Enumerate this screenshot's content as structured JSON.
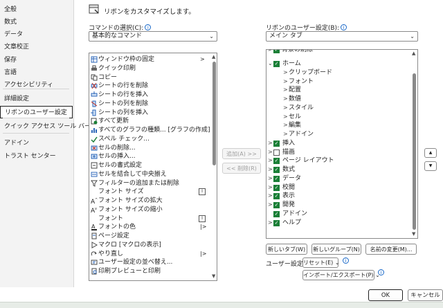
{
  "nav": {
    "items": [
      "全般",
      "数式",
      "データ",
      "文章校正",
      "保存",
      "言語",
      "アクセシビリティ",
      "詳細設定",
      "リボンのユーザー設定",
      "クイック アクセス ツール バー",
      "アドイン",
      "トラスト センター"
    ]
  },
  "header": {
    "title": "リボンをカスタマイズします。"
  },
  "commands": {
    "label": "コマンドの選択(C):",
    "selected": "基本的なコマンド",
    "items": [
      {
        "icon": "window-freeze-icon",
        "text": "ウィンドウ枠の固定",
        "arrow": ">"
      },
      {
        "icon": "quick-print-icon",
        "text": "クイック印刷",
        "arrow": ""
      },
      {
        "icon": "copy-icon",
        "text": "コピー",
        "arrow": ""
      },
      {
        "icon": "delete-row-icon",
        "text": "シートの行を削除",
        "arrow": ""
      },
      {
        "icon": "insert-row-icon",
        "text": "シートの行を挿入",
        "arrow": ""
      },
      {
        "icon": "delete-column-icon",
        "text": "シートの列を削除",
        "arrow": ""
      },
      {
        "icon": "insert-column-icon",
        "text": "シートの列を挿入",
        "arrow": ""
      },
      {
        "icon": "refresh-all-icon",
        "text": "すべて更新",
        "arrow": ""
      },
      {
        "icon": "chart-types-icon",
        "text": "すべてのグラフの種類... [グラフの作成]",
        "arrow": ""
      },
      {
        "icon": "spell-check-icon",
        "text": "スペル チェック...",
        "arrow": ""
      },
      {
        "icon": "delete-cells-icon",
        "text": "セルの削除...",
        "arrow": ""
      },
      {
        "icon": "insert-cells-icon",
        "text": "セルの挿入...",
        "arrow": ""
      },
      {
        "icon": "format-cells-icon",
        "text": "セルの書式設定",
        "arrow": ""
      },
      {
        "icon": "merge-center-icon",
        "text": "セルを結合して中央揃え",
        "arrow": ""
      },
      {
        "icon": "filter-icon",
        "text": "フィルターの追加または削除",
        "arrow": ""
      },
      {
        "icon": "",
        "text": "フォント サイズ",
        "arrow": "combo"
      },
      {
        "icon": "font-size-increase-icon",
        "text": "フォント サイズの拡大",
        "arrow": ""
      },
      {
        "icon": "font-size-decrease-icon",
        "text": "フォント サイズの縮小",
        "arrow": ""
      },
      {
        "icon": "",
        "text": "フォント",
        "arrow": "combo"
      },
      {
        "icon": "font-color-icon",
        "text": "フォントの色",
        "arrow": "|>"
      },
      {
        "icon": "page-setup-icon",
        "text": "ページ設定",
        "arrow": ""
      },
      {
        "icon": "macro-icon",
        "text": "マクロ [マクロの表示]",
        "arrow": ""
      },
      {
        "icon": "redo-icon",
        "text": "やり直し",
        "arrow": "|>"
      },
      {
        "icon": "custom-sort-icon",
        "text": "ユーザー設定の並べ替え...",
        "arrow": ""
      },
      {
        "icon": "print-preview-icon",
        "text": "印刷プレビューと印刷",
        "arrow": ""
      }
    ]
  },
  "ribbon": {
    "label": "リボンのユーザー設定(B):",
    "selected": "メイン タブ",
    "tree": [
      {
        "level": 0,
        "expander": "v",
        "check": "on",
        "text": "ホーム"
      },
      {
        "level": 1,
        "expander": ">",
        "check": "none",
        "text": "クリップボード"
      },
      {
        "level": 1,
        "expander": ">",
        "check": "none",
        "text": "フォント"
      },
      {
        "level": 1,
        "expander": ">",
        "check": "none",
        "text": "配置"
      },
      {
        "level": 1,
        "expander": ">",
        "check": "none",
        "text": "数値"
      },
      {
        "level": 1,
        "expander": ">",
        "check": "none",
        "text": "スタイル"
      },
      {
        "level": 1,
        "expander": ">",
        "check": "none",
        "text": "セル"
      },
      {
        "level": 1,
        "expander": ">",
        "check": "none",
        "text": "編集"
      },
      {
        "level": 1,
        "expander": ">",
        "check": "none",
        "text": "アドイン"
      },
      {
        "level": 0,
        "expander": ">",
        "check": "on",
        "text": "挿入"
      },
      {
        "level": 0,
        "expander": ">",
        "check": "off",
        "text": "描画"
      },
      {
        "level": 0,
        "expander": ">",
        "check": "on",
        "text": "ページ レイアウト"
      },
      {
        "level": 0,
        "expander": ">",
        "check": "on",
        "text": "数式"
      },
      {
        "level": 0,
        "expander": ">",
        "check": "on",
        "text": "データ"
      },
      {
        "level": 0,
        "expander": ">",
        "check": "on",
        "text": "校閲"
      },
      {
        "level": 0,
        "expander": ">",
        "check": "on",
        "text": "表示"
      },
      {
        "level": 0,
        "expander": ">",
        "check": "on",
        "text": "開発"
      },
      {
        "level": 0,
        "expander": "",
        "check": "on",
        "text": "アドイン"
      },
      {
        "level": 0,
        "expander": ">",
        "check": "on",
        "text": "ヘルプ"
      }
    ],
    "partial_top": "背景の削除"
  },
  "mid": {
    "add": "追加(A) >>",
    "remove": "<< 削除(R)"
  },
  "actions": {
    "new_tab": "新しいタブ(W)",
    "new_group": "新しいグループ(N)",
    "rename": "名前の変更(M)...",
    "user_settings": "ユーザー設定:",
    "reset": "リセット(E)",
    "import_export": "インポート/エクスポート(P)"
  },
  "footer": {
    "ok": "OK",
    "cancel": "キャンセル"
  },
  "colors": {
    "check_green": "#1a7f37",
    "info_blue": "#1b6ac9"
  }
}
